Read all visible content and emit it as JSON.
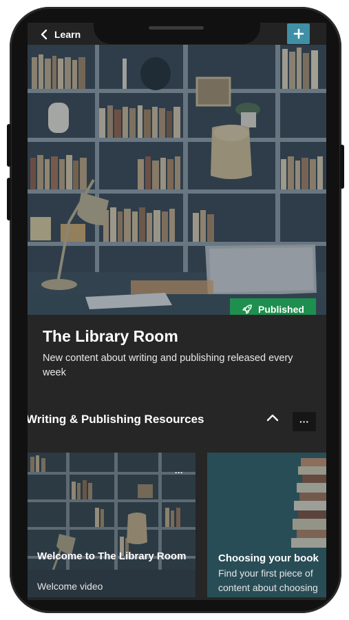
{
  "nav": {
    "back_label": "Learn",
    "add_icon": "plus-icon",
    "accent_color": "#3f8fa6"
  },
  "hero": {
    "badge_label": "Published",
    "badge_icon": "rocket-icon",
    "badge_color": "#1e8f4e"
  },
  "course": {
    "title": "The Library Room",
    "description": "New content about writing and publishing released every week"
  },
  "section": {
    "title": "Writing & Publishing Resources",
    "more_label": "···"
  },
  "cards": [
    {
      "title": "Welcome to The Library Room",
      "subtitle": "Welcome video",
      "more_label": "···"
    },
    {
      "title": "Choosing your book",
      "subtitle": "Find your first piece of content about choosing"
    }
  ]
}
